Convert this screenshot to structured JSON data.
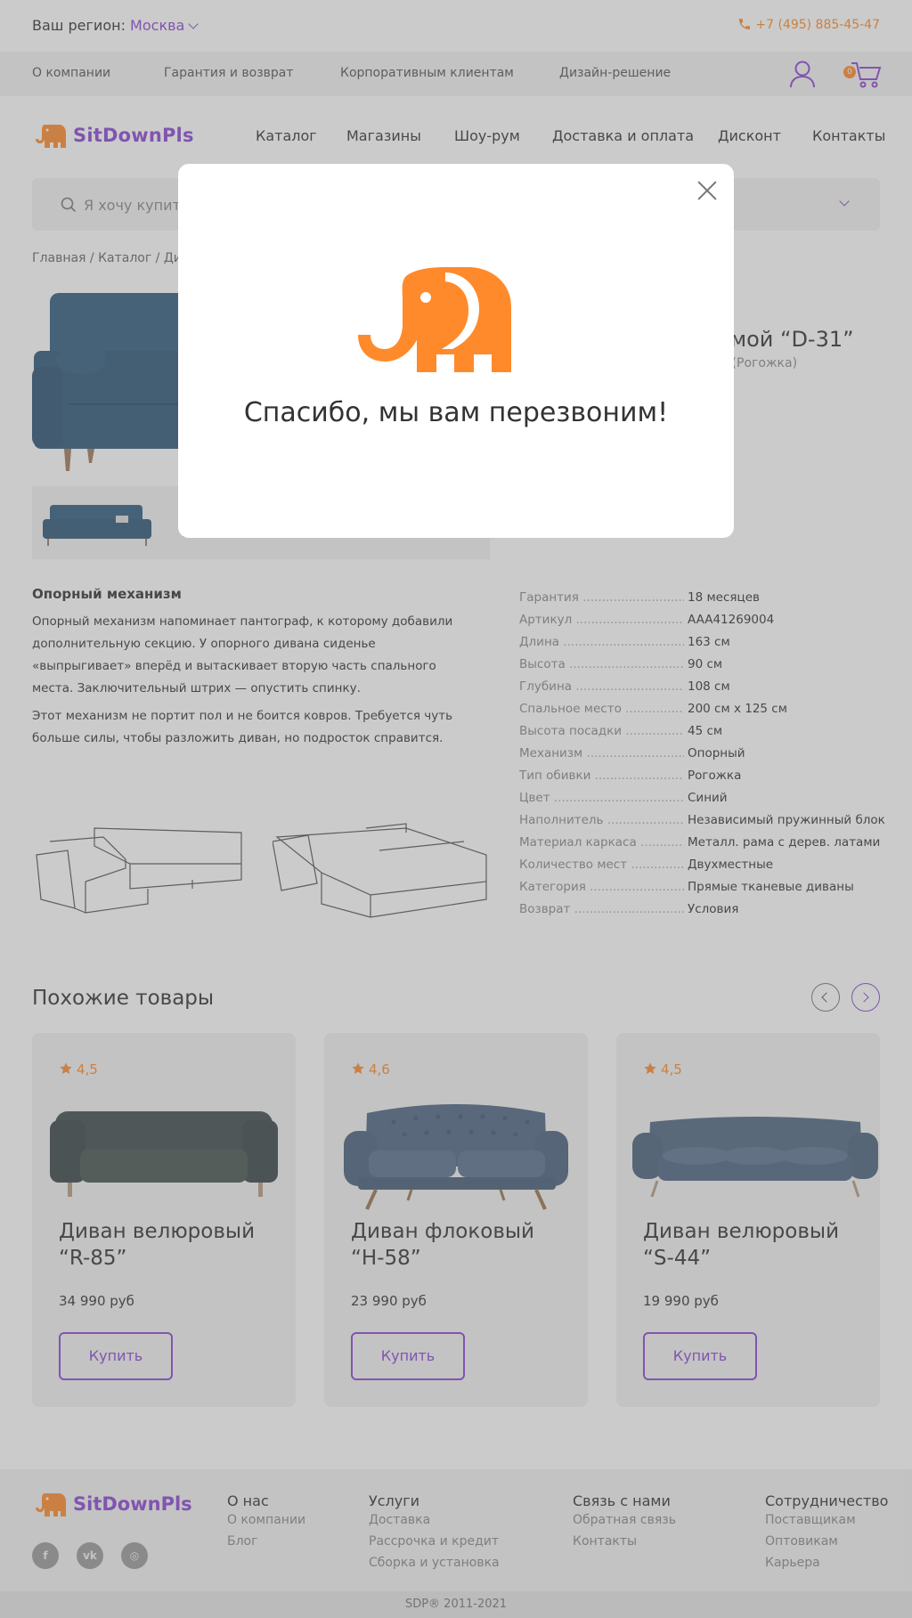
{
  "topbar": {
    "region_label": "Ваш регион:",
    "region_city": "Москва",
    "phone": "+7 (495) 885-45-47"
  },
  "secnav": {
    "items": [
      "О компании",
      "Гарантия и возврат",
      "Корпоративным клиентам",
      "Дизайн-решение"
    ],
    "cart_count": "0"
  },
  "header": {
    "logo_text": "SitDownPls",
    "nav": [
      "Каталог",
      "Магазины",
      "Шоу-рум",
      "Доставка и оплата",
      "Дисконт",
      "Контакты"
    ]
  },
  "search": {
    "placeholder": "Я хочу купить"
  },
  "breadcrumbs": "Главная  /  Каталог  /  Див",
  "product": {
    "title": "мой “D-31”",
    "subtitle": "й (Рогожка)"
  },
  "description": {
    "title": "Опорный механизм",
    "p1": "Опорный механизм напоминает пантограф, к которому добавили дополнительную секцию. У опорного дивана сиденье «выпрыгивает» вперёд и вытаскивает вторую часть спального места. Заключительный штрих — опустить спинку.",
    "p2": "Этот механизм не портит пол и не боится ковров. Требуется чуть больше силы, чтобы разложить диван, но подросток справится."
  },
  "specs": [
    {
      "k": "Гарантия",
      "v": "18 месяцев"
    },
    {
      "k": "Артикул",
      "v": "AAA41269004"
    },
    {
      "k": "Длина",
      "v": "163 см"
    },
    {
      "k": "Высота",
      "v": "90 см"
    },
    {
      "k": "Глубина",
      "v": "108 см"
    },
    {
      "k": "Спальное место",
      "v": "200 см х 125 см"
    },
    {
      "k": "Высота посадки",
      "v": "45 см"
    },
    {
      "k": "Механизм",
      "v": "Опорный"
    },
    {
      "k": "Тип обивки",
      "v": "Рогожка"
    },
    {
      "k": "Цвет",
      "v": "Синий"
    },
    {
      "k": "Наполнитель",
      "v": "Независимый пружинный блок"
    },
    {
      "k": "Материал каркаса",
      "v": "Металл. рама с дерев. латами"
    },
    {
      "k": "Количество мест",
      "v": "Двухместные"
    },
    {
      "k": "Категория",
      "v": "Прямые тканевые диваны"
    },
    {
      "k": "Возврат",
      "v": "Условия"
    }
  ],
  "similar": {
    "title": "Похожие товары",
    "buy_label": "Купить",
    "cards": [
      {
        "rating": "4,5",
        "name": "Диван велюровый “R-85”",
        "price": "34 990 руб",
        "color": "#3e4a4c"
      },
      {
        "rating": "4,6",
        "name": "Диван флоковый “H-58”",
        "price": "23 990 руб",
        "color": "#4d6580"
      },
      {
        "rating": "4,5",
        "name": "Диван велюровый “S-44”",
        "price": "19 990 руб",
        "color": "#4f6781"
      }
    ]
  },
  "footer": {
    "logo_text": "SitDownPls",
    "cols": [
      {
        "title": "О нас",
        "links": [
          "О компании",
          "Блог"
        ]
      },
      {
        "title": "Услуги",
        "links": [
          "Доставка",
          "Рассрочка и кредит",
          "Сборка и установка"
        ]
      },
      {
        "title": "Связь с нами",
        "links": [
          "Обратная связь",
          "Контакты"
        ]
      },
      {
        "title": "Сотрудничество",
        "links": [
          "Поставщикам",
          "Оптовикам",
          "Карьера"
        ]
      }
    ],
    "copyright": "SDP®   2011-2021"
  },
  "modal": {
    "message": "Спасибо, мы вам перезвоним!"
  },
  "colors": {
    "accent": "#8b45d6",
    "orange": "#ff8a2b",
    "sofa_main": "#2f5b7e"
  }
}
